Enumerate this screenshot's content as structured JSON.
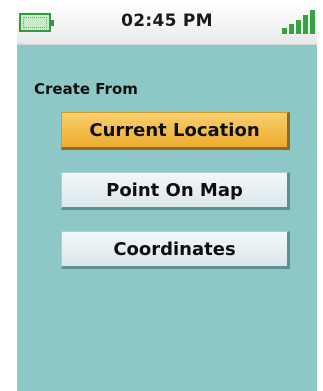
{
  "status_bar": {
    "time": "02:45 PM",
    "battery_icon": "battery-icon",
    "signal_icon": "signal-strength-icon"
  },
  "colors": {
    "background": "#8ec8c6",
    "selected_button": "#f4bd45",
    "normal_button": "#e6eef0"
  },
  "main": {
    "section_label": "Create From",
    "options": [
      {
        "label": "Current Location",
        "selected": true
      },
      {
        "label": "Point On Map",
        "selected": false
      },
      {
        "label": "Coordinates",
        "selected": false
      }
    ]
  }
}
